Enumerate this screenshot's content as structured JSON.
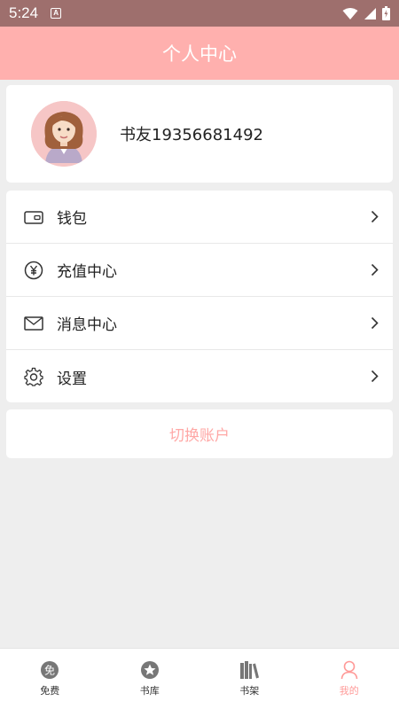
{
  "status_bar": {
    "time": "5:24",
    "notification_badge": "A"
  },
  "header": {
    "title": "个人中心"
  },
  "profile": {
    "username": "书友19356681492"
  },
  "menu": {
    "items": [
      {
        "label": "钱包",
        "icon": "wallet-icon"
      },
      {
        "label": "充值中心",
        "icon": "yuan-icon"
      },
      {
        "label": "消息中心",
        "icon": "mail-icon"
      },
      {
        "label": "设置",
        "icon": "gear-icon"
      }
    ]
  },
  "switch_account": {
    "label": "切换账户"
  },
  "bottom_nav": {
    "items": [
      {
        "label": "免费",
        "icon": "free-icon",
        "icon_text": "免"
      },
      {
        "label": "书库",
        "icon": "star-icon"
      },
      {
        "label": "书架",
        "icon": "books-icon"
      },
      {
        "label": "我的",
        "icon": "person-icon",
        "active": true
      }
    ]
  },
  "colors": {
    "status_bar": "#9e6f6d",
    "header": "#ffb0ae",
    "accent": "#ff9a98",
    "background": "#eeeeee"
  }
}
